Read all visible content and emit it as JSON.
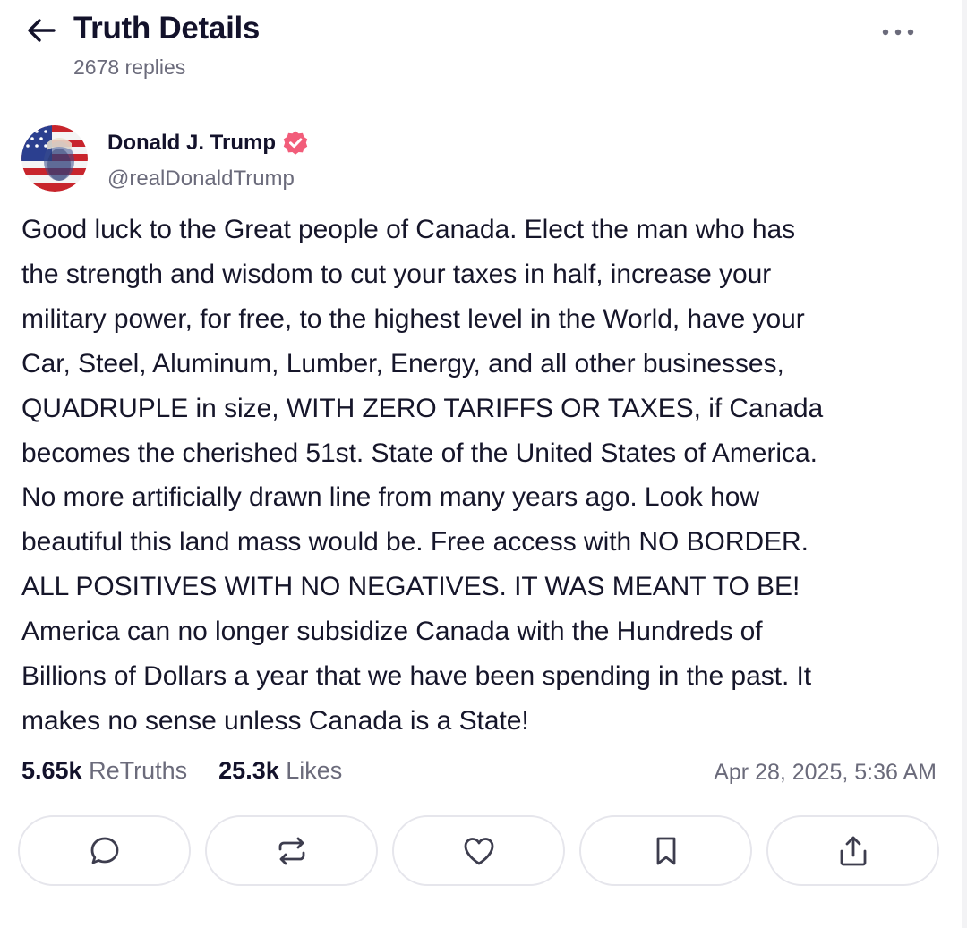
{
  "header": {
    "title": "Truth Details",
    "subtitle": "2678 replies",
    "back_icon": "arrow-left-icon",
    "more_icon": "more-horizontal-icon"
  },
  "author": {
    "name": "Donald J. Trump",
    "handle": "@realDonaldTrump",
    "verified": true,
    "verified_color": "#f25d7a"
  },
  "post": {
    "lines": [
      "Good luck to the Great people of Canada. Elect the man who has",
      "the strength and wisdom to cut your taxes in half, increase your",
      "military power, for free, to the highest level in the World, have your",
      "Car, Steel, Aluminum, Lumber, Energy, and all other businesses,",
      "QUADRUPLE in size, WITH ZERO TARIFFS OR TAXES, if Canada",
      "becomes the cherished 51st. State of the United States of America.",
      "No more artificially drawn line from many years ago. Look how",
      "beautiful this land mass would be. Free access with NO BORDER.",
      "ALL POSITIVES WITH NO NEGATIVES. IT WAS MEANT TO BE!",
      "America can no longer subsidize Canada with the Hundreds of",
      "Billions of Dollars a year that we have been spending in the past. It",
      "makes no sense unless Canada is a State!"
    ],
    "retruths_count": "5.65k",
    "retruths_label": "ReTruths",
    "likes_count": "25.3k",
    "likes_label": "Likes",
    "timestamp": "Apr 28, 2025, 5:36 AM"
  },
  "actions": [
    {
      "name": "reply",
      "icon": "comment-icon"
    },
    {
      "name": "retruth",
      "icon": "repost-icon"
    },
    {
      "name": "like",
      "icon": "heart-icon"
    },
    {
      "name": "bookmark",
      "icon": "bookmark-icon"
    },
    {
      "name": "share",
      "icon": "share-icon"
    }
  ],
  "colors": {
    "text_primary": "#13122b",
    "text_secondary": "#6b6b7b",
    "button_border": "#e6e6ec",
    "icon": "#3d3d4e"
  }
}
